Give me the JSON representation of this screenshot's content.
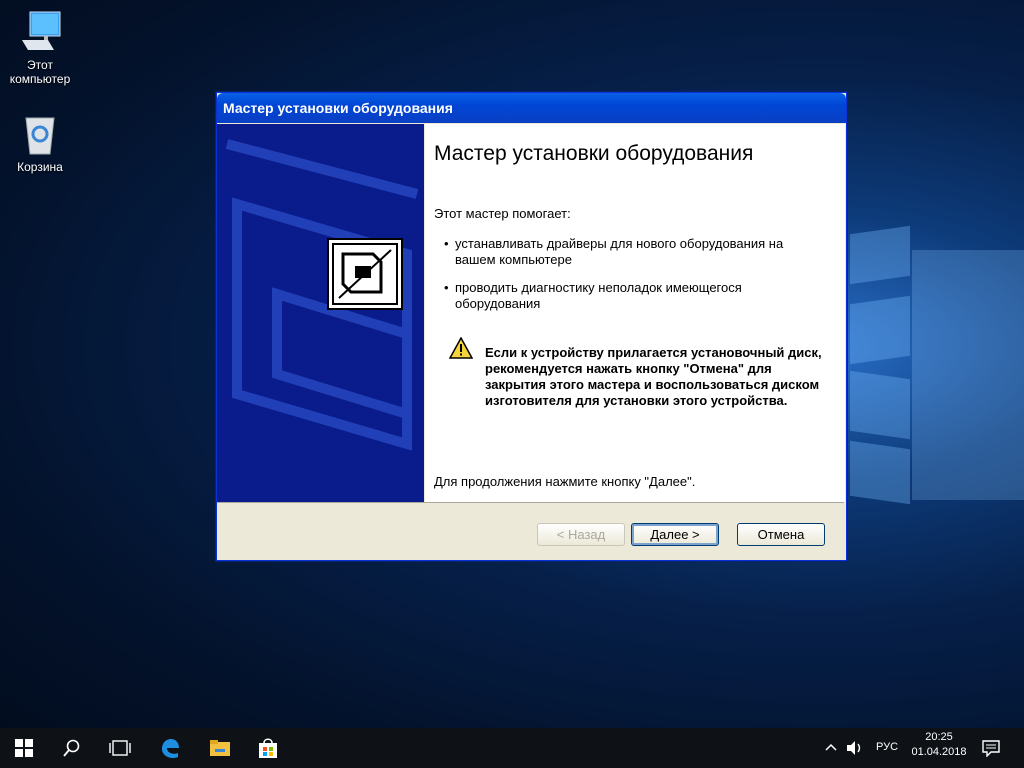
{
  "desktop": {
    "icons": [
      {
        "label_line1": "Этот",
        "label_line2": "компьютер",
        "icon": "computer-icon"
      },
      {
        "label_line1": "Корзина",
        "label_line2": "",
        "icon": "recycle-bin-icon"
      }
    ]
  },
  "wizard": {
    "title": "Мастер установки оборудования",
    "heading": "Мастер установки оборудования",
    "intro": "Этот мастер помогает:",
    "bullets": [
      "устанавливать драйверы для нового оборудования на вашем компьютере",
      "проводить диагностику неполадок имеющегося оборудования"
    ],
    "warning": "Если к устройству прилагается установочный диск, рекомендуется нажать кнопку \"Отмена\" для закрытия этого мастера и воспользоваться диском изготовителя для установки этого устройства.",
    "footnote": "Для продолжения нажмите кнопку \"Далее\".",
    "buttons": {
      "back": "< Назад",
      "next": "Далее >",
      "cancel": "Отмена"
    },
    "colors": {
      "title_blue": "#0046d5",
      "side_blue": "#0a1c8c",
      "warning_yellow": "#f5d33a"
    }
  },
  "taskbar": {
    "icons": [
      "windows-start-icon",
      "search-icon",
      "task-view-icon",
      "edge-icon",
      "file-explorer-icon",
      "store-icon"
    ],
    "language": "РУС",
    "time": "20:25",
    "date": "01.04.2018"
  }
}
